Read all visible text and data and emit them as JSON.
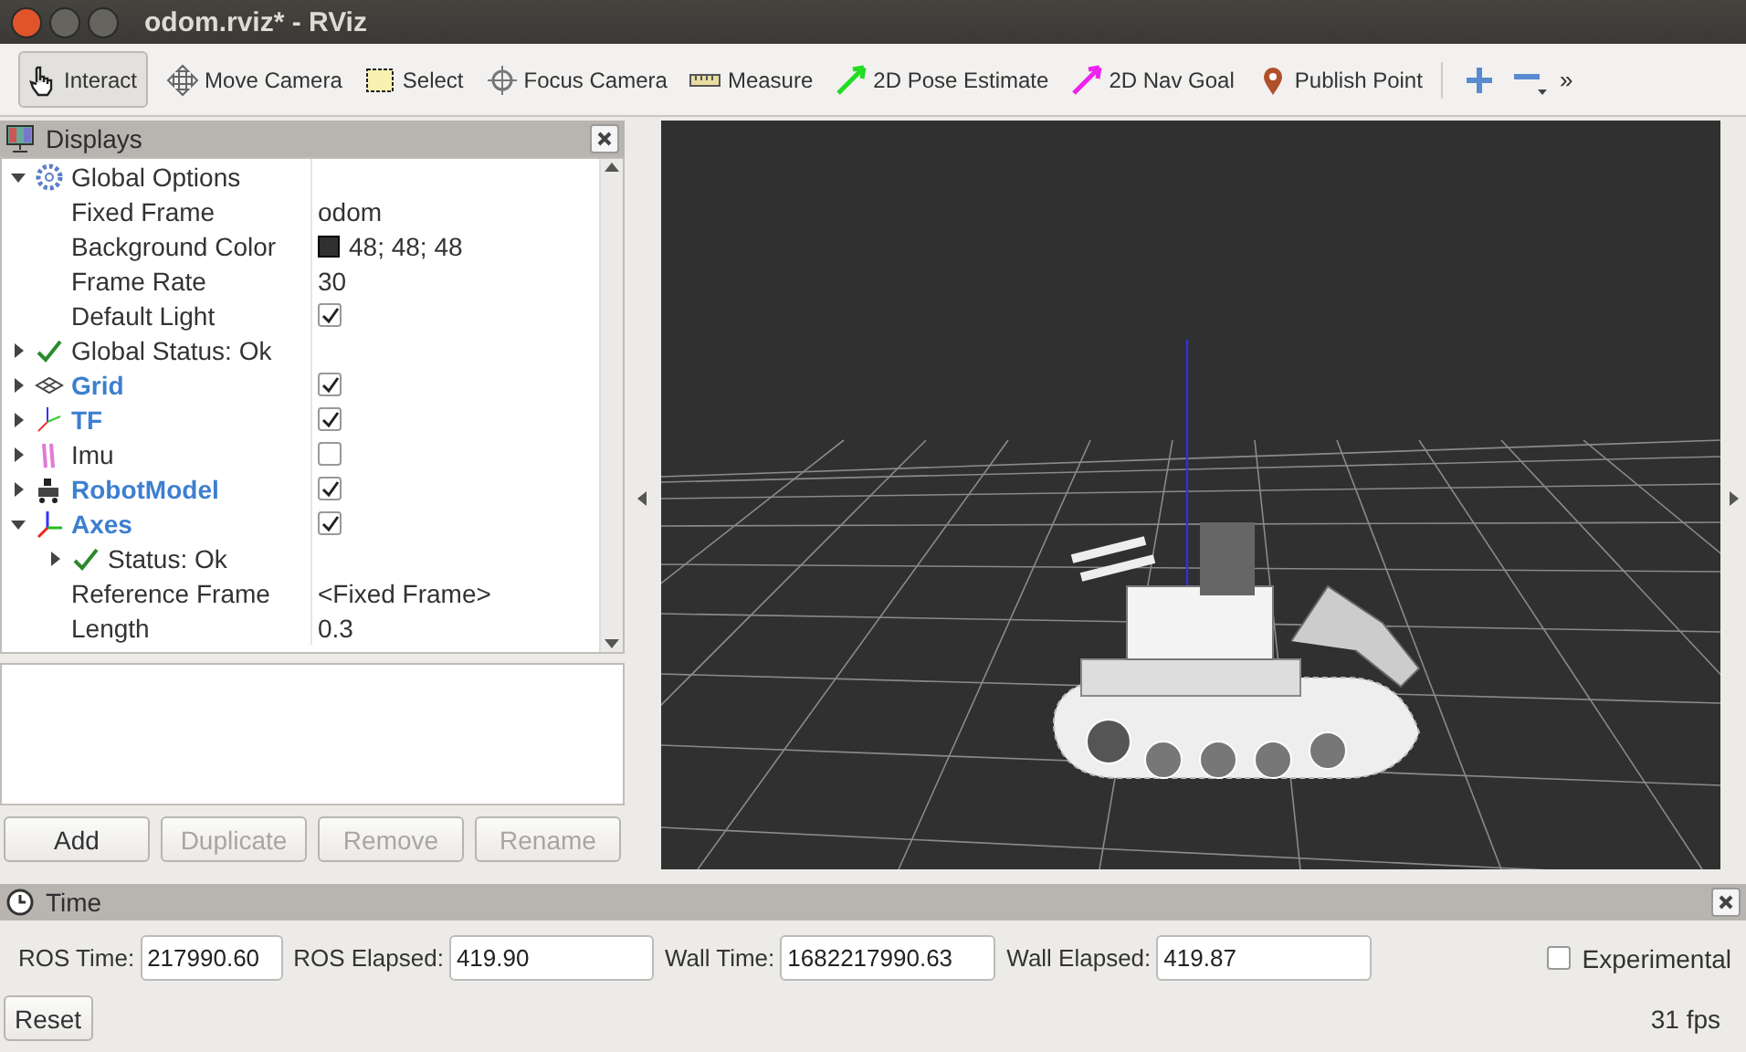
{
  "window": {
    "title": "odom.rviz* - RViz"
  },
  "toolbar": {
    "tools": [
      {
        "kind": "interact",
        "label": "Interact",
        "selected": true
      },
      {
        "kind": "move_camera",
        "label": "Move Camera",
        "selected": false
      },
      {
        "kind": "select",
        "label": "Select",
        "selected": false
      },
      {
        "kind": "focus_camera",
        "label": "Focus Camera",
        "selected": false
      },
      {
        "kind": "measure",
        "label": "Measure",
        "selected": false
      },
      {
        "kind": "pose_estimate",
        "label": "2D Pose Estimate",
        "selected": false
      },
      {
        "kind": "nav_goal",
        "label": "2D Nav Goal",
        "selected": false
      },
      {
        "kind": "publish_point",
        "label": "Publish Point",
        "selected": false
      }
    ],
    "overflow": "»"
  },
  "displays": {
    "title": "Displays",
    "tree": [
      {
        "kind": "group",
        "label": "Global Options",
        "expanded": true,
        "children": [
          {
            "kind": "property",
            "label": "Fixed Frame",
            "value": "odom"
          },
          {
            "kind": "color",
            "label": "Background Color",
            "value": "48; 48; 48"
          },
          {
            "kind": "property",
            "label": "Frame Rate",
            "value": "30"
          },
          {
            "kind": "property",
            "label": "Default Light",
            "checked": true
          }
        ]
      },
      {
        "kind": "status",
        "label": "Global Status: Ok",
        "expanded": false
      },
      {
        "kind": "grid",
        "label": "Grid",
        "expanded": false,
        "checked": true
      },
      {
        "kind": "tf",
        "label": "TF",
        "expanded": false,
        "checked": true
      },
      {
        "kind": "imu",
        "label": "Imu",
        "expanded": false,
        "checked": false
      },
      {
        "kind": "robot_model",
        "label": "RobotModel",
        "expanded": false,
        "checked": true
      },
      {
        "kind": "axes",
        "label": "Axes",
        "expanded": true,
        "checked": true,
        "children": [
          {
            "kind": "status",
            "label": "Status: Ok",
            "expanded": false
          },
          {
            "kind": "property",
            "label": "Reference Frame",
            "value": "<Fixed Frame>"
          },
          {
            "kind": "property",
            "label": "Length",
            "value": "0.3"
          }
        ]
      }
    ],
    "buttons": [
      {
        "label": "Add",
        "disabled": false
      },
      {
        "label": "Duplicate",
        "disabled": true
      },
      {
        "label": "Remove",
        "disabled": true
      },
      {
        "label": "Rename",
        "disabled": true
      }
    ]
  },
  "time": {
    "title": "Time",
    "fields": [
      {
        "label": "ROS Time:",
        "value": "217990.60"
      },
      {
        "label": "ROS Elapsed:",
        "value": "419.90"
      },
      {
        "label": "Wall Time:",
        "value": "1682217990.63"
      },
      {
        "label": "Wall Elapsed:",
        "value": "419.87"
      }
    ],
    "experimental": {
      "label": "Experimental",
      "checked": false
    },
    "reset": "Reset",
    "fps": "31 fps"
  }
}
